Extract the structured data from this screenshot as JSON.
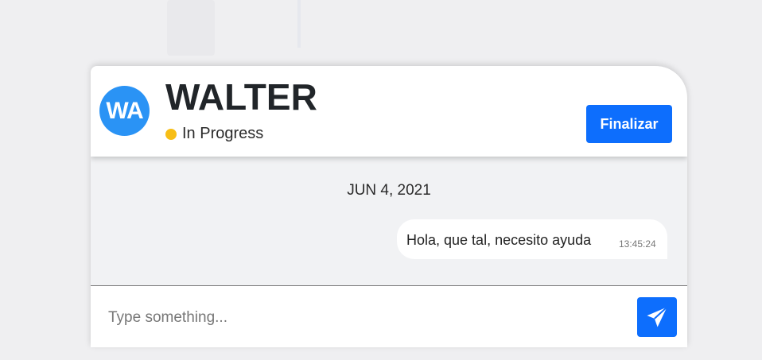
{
  "header": {
    "avatar_initials": "WA",
    "contact_name": "WALTER",
    "status_label": "In Progress",
    "status_color": "#f7be16",
    "finalize_label": "Finalizar"
  },
  "conversation": {
    "date_label": "JUN 4, 2021",
    "messages": [
      {
        "text": "Hola, que tal, necesito ayuda",
        "time": "13:45:24",
        "direction": "outgoing"
      }
    ]
  },
  "composer": {
    "placeholder": "Type something...",
    "value": "",
    "send_icon": "paper-plane-icon"
  },
  "colors": {
    "accent": "#0d6efd",
    "avatar_bg": "#2a93f5"
  }
}
